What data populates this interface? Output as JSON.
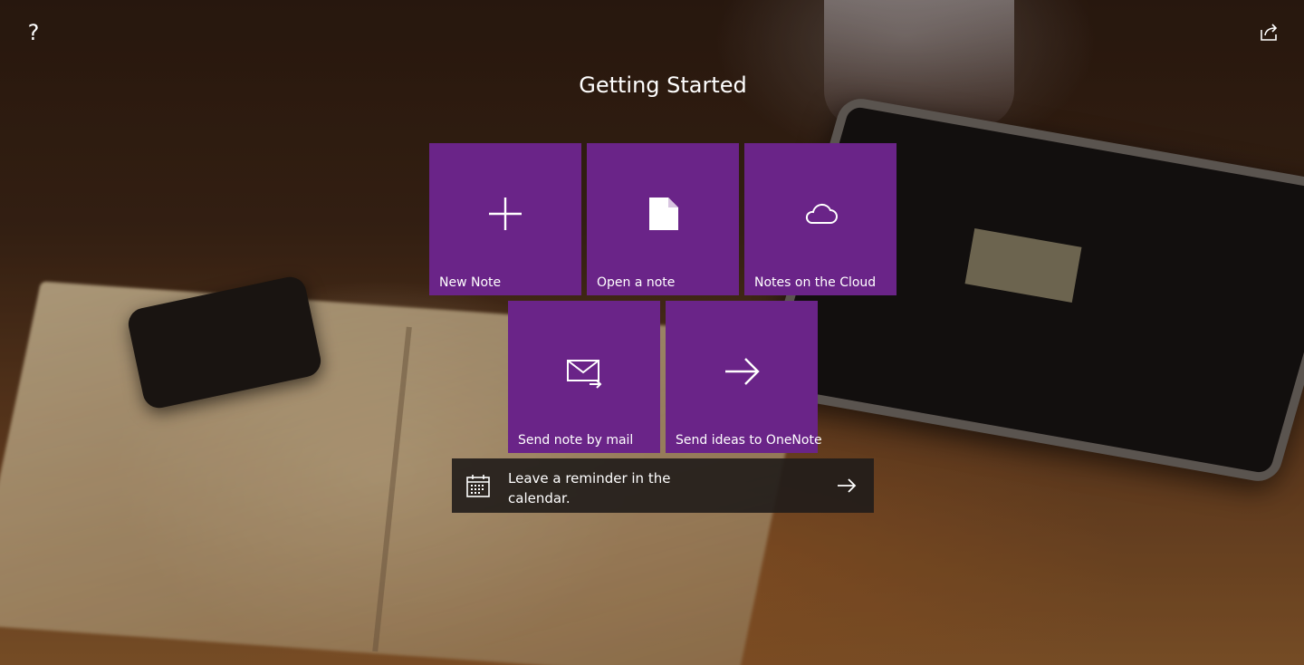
{
  "page": {
    "title": "Getting Started"
  },
  "toolbar": {
    "help_icon": "question-mark-icon",
    "help_glyph": "?",
    "share_icon": "share-icon"
  },
  "tiles": [
    {
      "label": "New Note",
      "icon": "plus-icon"
    },
    {
      "label": "Open a note",
      "icon": "document-icon"
    },
    {
      "label": "Notes on the Cloud",
      "icon": "cloud-icon"
    },
    {
      "label": "Send note by mail",
      "icon": "mail-send-icon"
    },
    {
      "label": "Send ideas to OneNote",
      "icon": "arrow-right-icon"
    }
  ],
  "reminder": {
    "text": "Leave a reminder in the calendar.",
    "icon": "calendar-icon",
    "action_icon": "arrow-right-icon"
  },
  "colors": {
    "tile": "#6a2488",
    "reminder_bar": "#201c1a",
    "text": "#ffffff"
  }
}
